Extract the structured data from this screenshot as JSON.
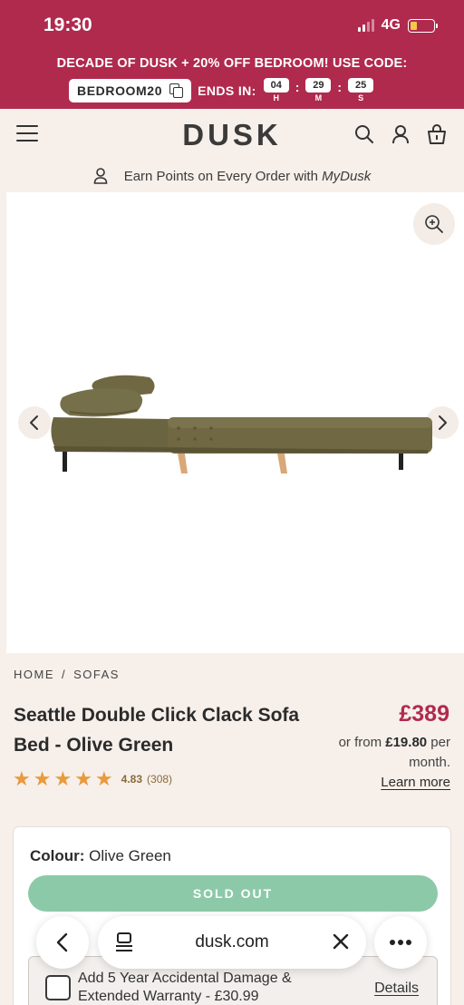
{
  "status": {
    "time": "19:30",
    "network": "4G"
  },
  "promo": {
    "headline": "DECADE OF DUSK + 20% OFF BEDROOM! USE CODE:",
    "code": "BEDROOM20",
    "ends_label": "ENDS IN:",
    "timer": [
      {
        "value": "04",
        "unit": "H"
      },
      {
        "value": "29",
        "unit": "M"
      },
      {
        "value": "25",
        "unit": "S"
      }
    ]
  },
  "header": {
    "logo": "DUSK"
  },
  "points": {
    "text_prefix": "Earn Points on Every Order with ",
    "brand": "MyDusk"
  },
  "breadcrumb": {
    "home": "HOME",
    "separator": "/",
    "category": "SOFAS"
  },
  "product": {
    "title": "Seattle Double Click Clack Sofa Bed - Olive Green",
    "price": "£389",
    "finance_prefix": "or from ",
    "finance_amount": "£19.80",
    "finance_suffix": " per month.",
    "learn_more": "Learn more",
    "rating_value": "4.83",
    "rating_count": "(308)",
    "stars": 5
  },
  "options": {
    "colour_label": "Colour:",
    "colour_value": "Olive Green",
    "sold_out": "SOLD OUT",
    "warranty_text": "Add 5 Year Accidental Damage & Extended Warranty - £30.99",
    "warranty_details": "Details"
  },
  "browser": {
    "url": "dusk.com"
  },
  "colors": {
    "brand_red": "#b02a4e",
    "sold_out_green": "#8cc9a8",
    "star": "#e89a3c",
    "sofa_olive": "#6b6440"
  }
}
